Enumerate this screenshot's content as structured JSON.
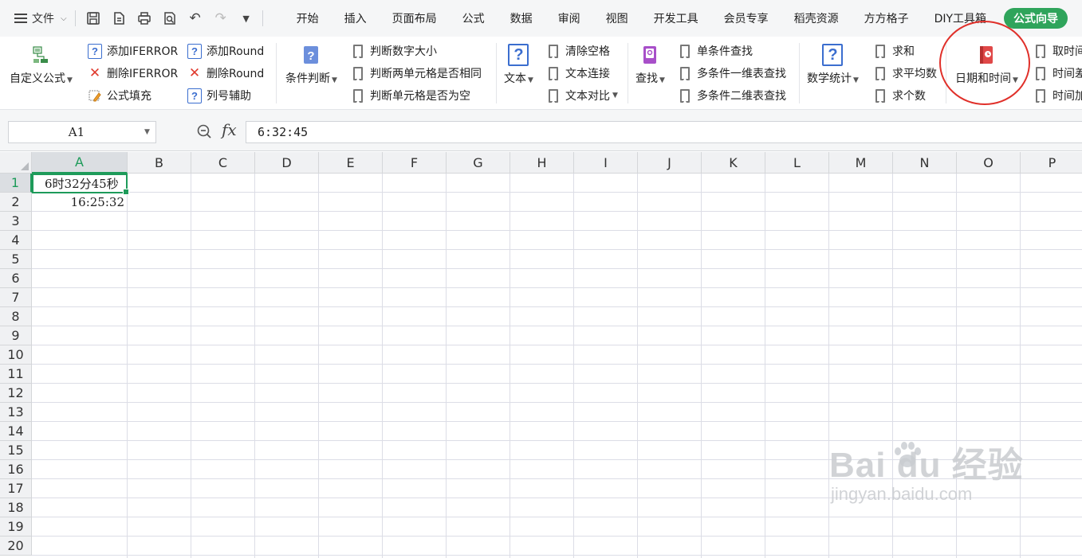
{
  "menubar": {
    "file_label": "文件",
    "tabs": [
      "开始",
      "插入",
      "页面布局",
      "公式",
      "数据",
      "审阅",
      "视图",
      "开发工具",
      "会员专享",
      "稻壳资源",
      "方方格子",
      "DIY工具箱"
    ],
    "active_tab": "公式向导",
    "active_tab_color": "#2fa45b"
  },
  "ribbon": {
    "custom_formula": "自定义公式",
    "add_iferror": "添加IFERROR",
    "delete_iferror": "删除IFERROR",
    "formula_fill": "公式填充",
    "add_round": "添加Round",
    "delete_round": "删除Round",
    "column_helper": "列号辅助",
    "condition_judge": "条件判断",
    "judge_number_size": "判断数字大小",
    "judge_two_cells_same": "判断两单元格是否相同",
    "judge_cell_empty": "判断单元格是否为空",
    "text": "文本",
    "clear_spaces": "清除空格",
    "text_concat": "文本连接",
    "text_compare": "文本对比",
    "lookup": "查找",
    "single_lookup": "单条件查找",
    "multi_1d_lookup": "多条件一维表查找",
    "multi_2d_lookup": "多条件二维表查找",
    "math_stats": "数学统计",
    "sum": "求和",
    "average": "求平均数",
    "count": "求个数",
    "date_time": "日期和时间",
    "get_time": "取时间",
    "time_diff": "时间差",
    "time_add": "时间加"
  },
  "formula_bar": {
    "name_box": "A1",
    "fx_label": "fx",
    "formula": "6:32:45"
  },
  "grid": {
    "columns": [
      "A",
      "B",
      "C",
      "D",
      "E",
      "F",
      "G",
      "H",
      "I",
      "J",
      "K",
      "L",
      "M",
      "N",
      "O",
      "P"
    ],
    "rows": [
      "1",
      "2",
      "3",
      "4",
      "5",
      "6",
      "7",
      "8",
      "9",
      "10",
      "11",
      "12",
      "13",
      "14",
      "15",
      "16",
      "17",
      "18",
      "19",
      "20"
    ],
    "selected_column": "A",
    "selected_row": "1",
    "cells": {
      "A1": "6时32分45秒",
      "A2": "16:25:32"
    },
    "selection_color": "#1e9b5a"
  },
  "watermark": {
    "brand": "Bai du 经验",
    "url": "jingyan.baidu.com"
  },
  "highlight_color": "#e0302a"
}
